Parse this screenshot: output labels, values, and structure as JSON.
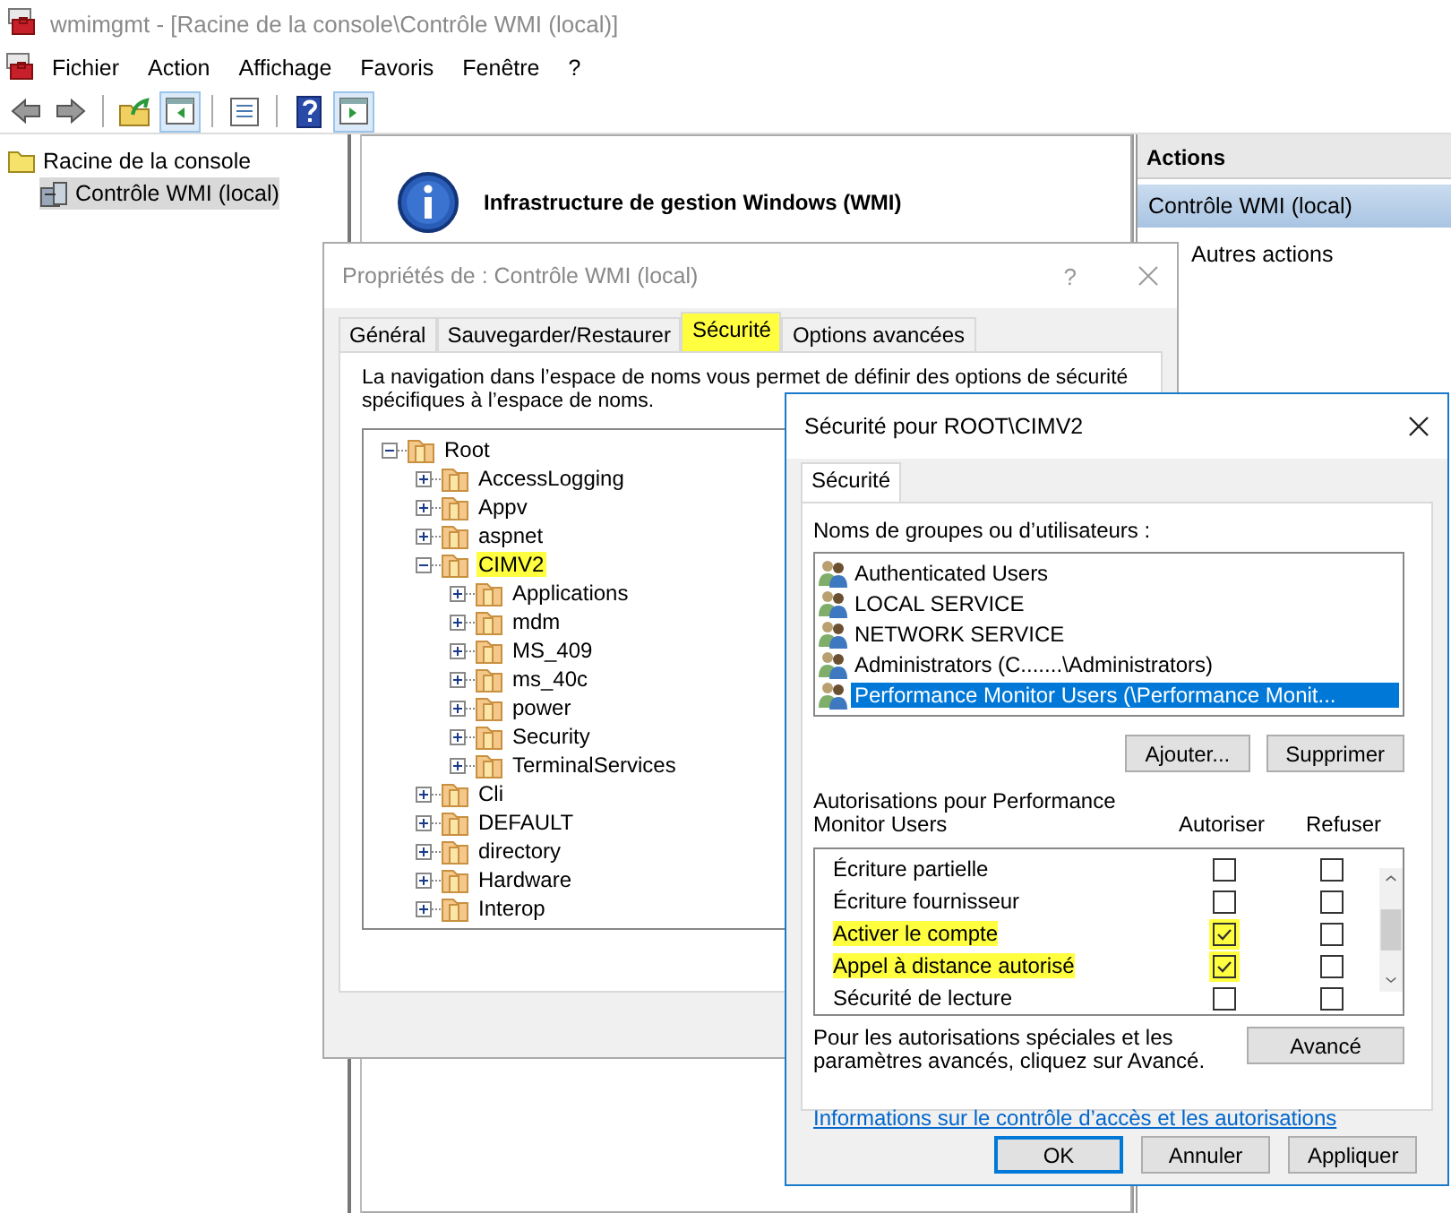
{
  "window": {
    "title": "wmimgmt - [Racine de la console\\Contrôle WMI (local)]"
  },
  "menu": [
    "Fichier",
    "Action",
    "Affichage",
    "Favoris",
    "Fenêtre",
    "?"
  ],
  "toolbar": [
    {
      "kind": "back",
      "pressed": false
    },
    {
      "kind": "forward",
      "pressed": false
    },
    {
      "kind": "separator"
    },
    {
      "kind": "up",
      "pressed": false
    },
    {
      "kind": "tree",
      "pressed": true
    },
    {
      "kind": "separator"
    },
    {
      "kind": "properties",
      "pressed": false
    },
    {
      "kind": "separator"
    },
    {
      "kind": "help",
      "pressed": false
    },
    {
      "kind": "actionpane",
      "pressed": true
    }
  ],
  "console_tree": [
    {
      "label": "Racine de la console",
      "kind": "folder",
      "selected": false,
      "children": [
        {
          "label": "Contrôle WMI (local)",
          "kind": "computer",
          "selected": true
        }
      ]
    }
  ],
  "center": {
    "heading": "Infrastructure de gestion Windows (WMI)"
  },
  "actions": {
    "title": "Actions",
    "items": [
      {
        "label": "Contrôle WMI (local)",
        "kind": "header"
      },
      {
        "label": "Autres actions",
        "kind": "item"
      }
    ]
  },
  "properties_dialog": {
    "title": "Propriétés de : Contrôle WMI (local)",
    "help": "?",
    "tabs": [
      {
        "label": "Général",
        "selected": false,
        "highlighted": false
      },
      {
        "label": "Sauvegarder/Restaurer",
        "selected": false,
        "highlighted": false
      },
      {
        "label": "Sécurité",
        "selected": true,
        "highlighted": true
      },
      {
        "label": "Options avancées",
        "selected": false,
        "highlighted": false
      }
    ],
    "description": "La navigation dans l’espace de noms vous permet de définir des options de sécurité spécifiques à l’espace de noms.",
    "namespaces": [
      {
        "label": "Root",
        "expanded": true,
        "highlighted": false,
        "children": [
          {
            "label": "AccessLogging",
            "expanded": false,
            "highlighted": false
          },
          {
            "label": "Appv",
            "expanded": false,
            "highlighted": false
          },
          {
            "label": "aspnet",
            "expanded": false,
            "highlighted": false
          },
          {
            "label": "CIMV2",
            "expanded": true,
            "highlighted": true,
            "children": [
              {
                "label": "Applications",
                "expanded": false,
                "highlighted": false
              },
              {
                "label": "mdm",
                "expanded": false,
                "highlighted": false
              },
              {
                "label": "MS_409",
                "expanded": false,
                "highlighted": false
              },
              {
                "label": "ms_40c",
                "expanded": false,
                "highlighted": false
              },
              {
                "label": "power",
                "expanded": false,
                "highlighted": false
              },
              {
                "label": "Security",
                "expanded": false,
                "highlighted": false
              },
              {
                "label": "TerminalServices",
                "expanded": false,
                "highlighted": false
              }
            ]
          },
          {
            "label": "Cli",
            "expanded": false,
            "highlighted": false
          },
          {
            "label": "DEFAULT",
            "expanded": false,
            "highlighted": false
          },
          {
            "label": "directory",
            "expanded": false,
            "highlighted": false
          },
          {
            "label": "Hardware",
            "expanded": false,
            "highlighted": false
          },
          {
            "label": "Interop",
            "expanded": false,
            "highlighted": false
          }
        ]
      }
    ]
  },
  "security_dialog": {
    "title": "Sécurité pour ROOT\\CIMV2",
    "tab": "Sécurité",
    "users_label": "Noms de groupes ou d’utilisateurs :",
    "users": [
      {
        "name": "Authenticated Users",
        "selected": false
      },
      {
        "name": "LOCAL SERVICE",
        "selected": false
      },
      {
        "name": "NETWORK SERVICE",
        "selected": false
      },
      {
        "name": "Administrators (C.......\\Administrators)",
        "selected": false
      },
      {
        "name": "Performance Monitor Users (\\Performance Monit...",
        "selected": true
      }
    ],
    "user_buttons": [
      "Ajouter...",
      "Supprimer"
    ],
    "permissions_label": "Autorisations pour Performance Monitor Users",
    "columns": [
      "Autoriser",
      "Refuser"
    ],
    "permissions": [
      {
        "name": "Écriture partielle",
        "allow": false,
        "deny": false,
        "highlighted": false
      },
      {
        "name": "Écriture fournisseur",
        "allow": false,
        "deny": false,
        "highlighted": false
      },
      {
        "name": "Activer le compte",
        "allow": true,
        "deny": false,
        "highlighted": true
      },
      {
        "name": "Appel à distance autorisé",
        "allow": true,
        "deny": false,
        "highlighted": true
      },
      {
        "name": "Sécurité de lecture",
        "allow": false,
        "deny": false,
        "highlighted": false
      }
    ],
    "advanced_note": "Pour les autorisations spéciales et les paramètres avancés, cliquez sur Avancé.",
    "advanced_button": "Avancé",
    "link": "Informations sur le contrôle d’accès et les autorisations",
    "buttons": [
      {
        "label": "OK",
        "default": true
      },
      {
        "label": "Annuler",
        "default": false
      },
      {
        "label": "Appliquer",
        "default": false
      }
    ]
  }
}
